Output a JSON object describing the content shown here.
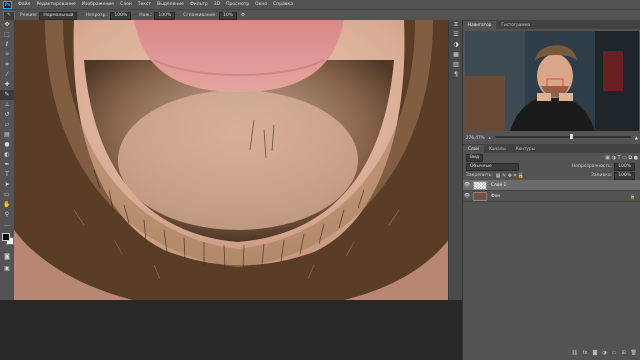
{
  "app": {
    "logo_text": "Ps"
  },
  "menu": [
    "Файл",
    "Редактирование",
    "Изображение",
    "Слои",
    "Текст",
    "Выделение",
    "Фильтр",
    "3D",
    "Просмотр",
    "Окно",
    "Справка"
  ],
  "options": {
    "mode_label": "Режим:",
    "mode_value": "Нормальный",
    "opacity_label": "Непрозр.:",
    "opacity_value": "100%",
    "flow_label": "Наж.:",
    "flow_value": "100%",
    "smoothing_label": "Сглаживание:",
    "smoothing_value": "10%"
  },
  "tools": [
    "move-tool",
    "marquee-tool",
    "lasso-tool",
    "quick-select-tool",
    "crop-tool",
    "eyedropper-tool",
    "healing-brush-tool",
    "brush-tool",
    "clone-stamp-tool",
    "history-brush-tool",
    "eraser-tool",
    "gradient-tool",
    "blur-tool",
    "dodge-tool",
    "pen-tool",
    "type-tool",
    "path-select-tool",
    "shape-tool",
    "hand-tool",
    "zoom-tool",
    "more-tools"
  ],
  "right_panel": {
    "nav_tabs": [
      "Навигатор",
      "Гистограмма"
    ],
    "zoom_value": "226,47%",
    "layers_tabs": [
      "Слои",
      "Каналы",
      "Контуры"
    ],
    "filter_label": "Вид",
    "blend_mode": "Обычные",
    "opacity_label": "Непрозрачность:",
    "opacity_value": "100%",
    "lock_label": "Закрепить:",
    "fill_label": "Заливка:",
    "fill_value": "100%",
    "layers": [
      {
        "name": "Слой 1",
        "active": true
      },
      {
        "name": "Фон",
        "active": false
      }
    ]
  },
  "colors": {
    "panel_bg": "#535353",
    "workspace_bg": "#282828"
  }
}
